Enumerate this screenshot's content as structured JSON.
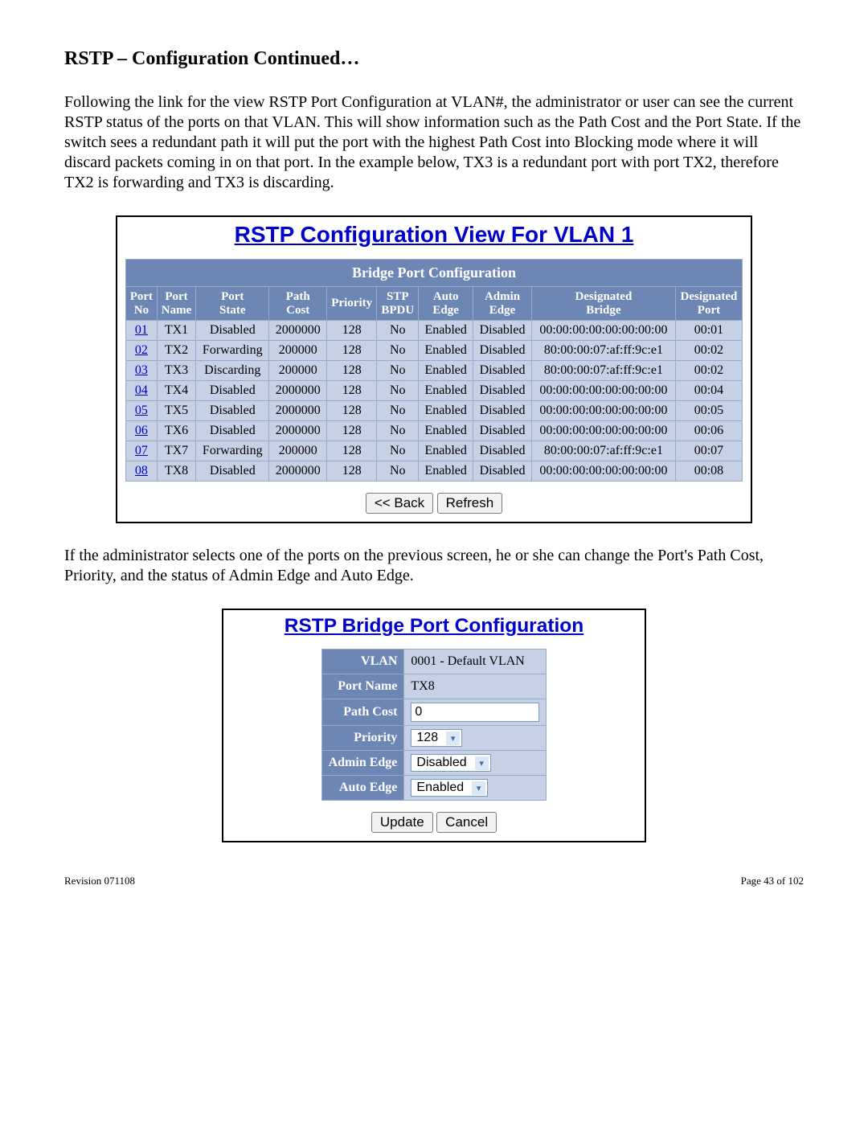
{
  "heading": "RSTP – Configuration Continued…",
  "para1": "Following the link for the view RSTP Port Configuration at VLAN#, the administrator or user can see the current RSTP status of the ports on that VLAN.  This will show information such as the Path Cost and the Port State.  If the switch sees a redundant path it will put the port with the highest Path Cost into Blocking mode where it will discard packets coming in on that port. In the example below, TX3 is a redundant port with port TX2, therefore TX2 is forwarding and TX3 is discarding.",
  "panel1_title": "RSTP Configuration View For VLAN 1",
  "table1_caption": "Bridge Port Configuration",
  "table1_columns": [
    "Port No",
    "Port Name",
    "Port State",
    "Path Cost",
    "Priority",
    "STP BPDU",
    "Auto Edge",
    "Admin Edge",
    "Designated Bridge",
    "Designated Port"
  ],
  "table1_rows": [
    {
      "no": "01",
      "name": "TX1",
      "state": "Disabled",
      "cost": "2000000",
      "prio": "128",
      "bpdu": "No",
      "auto": "Enabled",
      "admin": "Disabled",
      "dbridge": "00:00:00:00:00:00:00:00",
      "dport": "00:01"
    },
    {
      "no": "02",
      "name": "TX2",
      "state": "Forwarding",
      "cost": "200000",
      "prio": "128",
      "bpdu": "No",
      "auto": "Enabled",
      "admin": "Disabled",
      "dbridge": "80:00:00:07:af:ff:9c:e1",
      "dport": "00:02"
    },
    {
      "no": "03",
      "name": "TX3",
      "state": "Discarding",
      "cost": "200000",
      "prio": "128",
      "bpdu": "No",
      "auto": "Enabled",
      "admin": "Disabled",
      "dbridge": "80:00:00:07:af:ff:9c:e1",
      "dport": "00:02"
    },
    {
      "no": "04",
      "name": "TX4",
      "state": "Disabled",
      "cost": "2000000",
      "prio": "128",
      "bpdu": "No",
      "auto": "Enabled",
      "admin": "Disabled",
      "dbridge": "00:00:00:00:00:00:00:00",
      "dport": "00:04"
    },
    {
      "no": "05",
      "name": "TX5",
      "state": "Disabled",
      "cost": "2000000",
      "prio": "128",
      "bpdu": "No",
      "auto": "Enabled",
      "admin": "Disabled",
      "dbridge": "00:00:00:00:00:00:00:00",
      "dport": "00:05"
    },
    {
      "no": "06",
      "name": "TX6",
      "state": "Disabled",
      "cost": "2000000",
      "prio": "128",
      "bpdu": "No",
      "auto": "Enabled",
      "admin": "Disabled",
      "dbridge": "00:00:00:00:00:00:00:00",
      "dport": "00:06"
    },
    {
      "no": "07",
      "name": "TX7",
      "state": "Forwarding",
      "cost": "200000",
      "prio": "128",
      "bpdu": "No",
      "auto": "Enabled",
      "admin": "Disabled",
      "dbridge": "80:00:00:07:af:ff:9c:e1",
      "dport": "00:07"
    },
    {
      "no": "08",
      "name": "TX8",
      "state": "Disabled",
      "cost": "2000000",
      "prio": "128",
      "bpdu": "No",
      "auto": "Enabled",
      "admin": "Disabled",
      "dbridge": "00:00:00:00:00:00:00:00",
      "dport": "00:08"
    }
  ],
  "back_label": "<< Back",
  "refresh_label": "Refresh",
  "para2": "If the administrator selects one of the ports on the previous screen, he or she can change the Port's Path Cost, Priority, and the status of Admin Edge and Auto Edge.",
  "panel2_title": "RSTP Bridge Port Configuration",
  "form": {
    "vlan_label": "VLAN",
    "vlan_value": "0001 - Default VLAN",
    "portname_label": "Port Name",
    "portname_value": "TX8",
    "pathcost_label": "Path Cost",
    "pathcost_value": "0",
    "priority_label": "Priority",
    "priority_value": "128",
    "adminedge_label": "Admin Edge",
    "adminedge_value": "Disabled",
    "autoedge_label": "Auto Edge",
    "autoedge_value": "Enabled"
  },
  "update_label": "Update",
  "cancel_label": "Cancel",
  "footer_left": "Revision 071108",
  "footer_right": "Page 43 of 102"
}
